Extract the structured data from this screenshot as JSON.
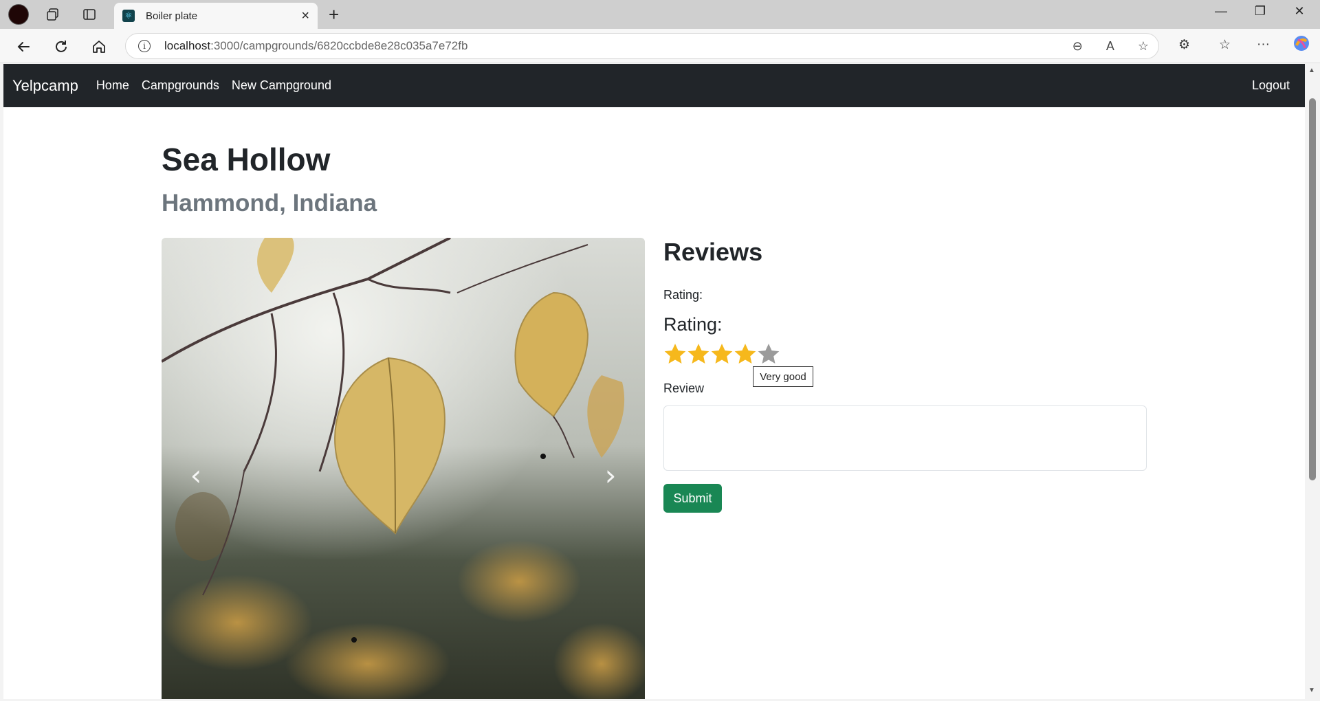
{
  "browser": {
    "tab_title": "Boiler plate",
    "url_host": "localhost",
    "url_path": ":3000/campgrounds/6820ccbde8e28c035a7e72fb"
  },
  "navbar": {
    "brand": "Yelpcamp",
    "links": [
      "Home",
      "Campgrounds",
      "New Campground"
    ],
    "logout": "Logout"
  },
  "campground": {
    "title": "Sea Hollow",
    "location": "Hammond, Indiana"
  },
  "reviews": {
    "heading": "Reviews",
    "rating_label_small": "Rating:",
    "rating_label_large": "Rating:",
    "rating_value": 4,
    "rating_max": 5,
    "tooltip": "Very good",
    "review_label": "Review",
    "review_value": "",
    "submit_label": "Submit"
  },
  "colors": {
    "navbar_bg": "#212529",
    "submit_bg": "#198754",
    "star_active": "#f6b81c",
    "star_inactive": "#9b9b9b"
  }
}
